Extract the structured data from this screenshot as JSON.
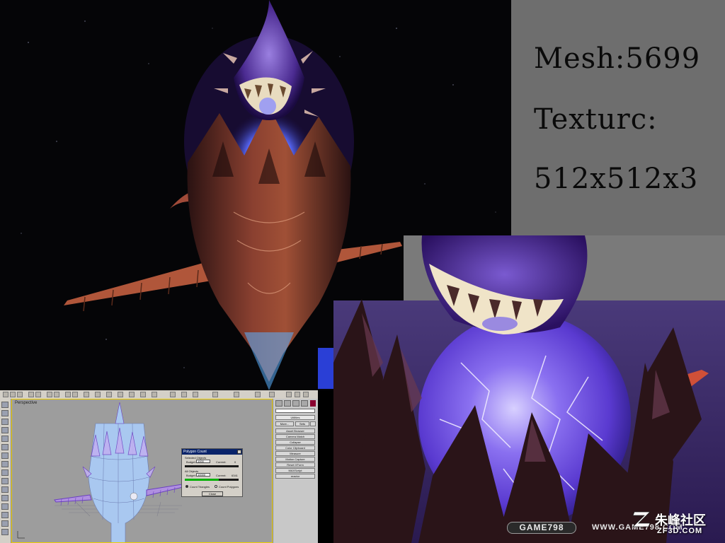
{
  "stats": {
    "mesh": "Mesh:5699",
    "texture_label": "Texturc:",
    "texture_size": "512x512x3"
  },
  "max_window": {
    "viewport_label": "Perspective",
    "poly_count_dialog": {
      "title": "Polygon Count",
      "selected_objects_label": "Selected Objects",
      "selected_budget_label": "Budget:",
      "selected_budget_value": "1000",
      "selected_current_label": "Current:",
      "selected_current_value": "0",
      "all_objects_label": "All Objects",
      "all_budget_label": "Budget:",
      "all_budget_value": "10000",
      "all_current_label": "Current:",
      "all_current_value": "6341",
      "count_triangles": "Count Triangles",
      "count_polygons": "Count Polygons",
      "close_button": "Close"
    },
    "command_panel": {
      "utilities_label": "Utilities",
      "more_button": "More...",
      "sets_button": "Sets",
      "buttons": [
        "Asset Browser",
        "Camera Match",
        "Collapse",
        "Color Clipboard",
        "Measure",
        "Motion Capture",
        "Reset XForm",
        "MAXScript",
        "reactor"
      ]
    }
  },
  "watermark": {
    "game_badge": "GAME798",
    "url": "WWW.GAME798.COM",
    "site_name_cn": "朱峰社区",
    "site_domain": "ZF3D.COM"
  },
  "colors": {
    "stats_panel_bg": "#6e6e6e",
    "marker_blue": "#2a3fd6",
    "viewport_border": "#f0d000",
    "model_blue": "#a9c8f0",
    "wire_purple": "#6a40c0"
  }
}
